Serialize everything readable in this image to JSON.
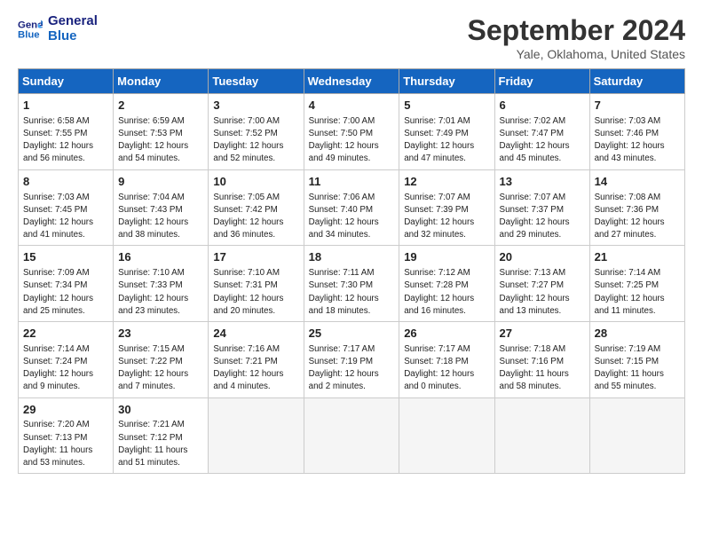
{
  "logo": {
    "line1": "General",
    "line2": "Blue"
  },
  "title": "September 2024",
  "subtitle": "Yale, Oklahoma, United States",
  "weekdays": [
    "Sunday",
    "Monday",
    "Tuesday",
    "Wednesday",
    "Thursday",
    "Friday",
    "Saturday"
  ],
  "weeks": [
    [
      {
        "day": "1",
        "info": "Sunrise: 6:58 AM\nSunset: 7:55 PM\nDaylight: 12 hours\nand 56 minutes."
      },
      {
        "day": "2",
        "info": "Sunrise: 6:59 AM\nSunset: 7:53 PM\nDaylight: 12 hours\nand 54 minutes."
      },
      {
        "day": "3",
        "info": "Sunrise: 7:00 AM\nSunset: 7:52 PM\nDaylight: 12 hours\nand 52 minutes."
      },
      {
        "day": "4",
        "info": "Sunrise: 7:00 AM\nSunset: 7:50 PM\nDaylight: 12 hours\nand 49 minutes."
      },
      {
        "day": "5",
        "info": "Sunrise: 7:01 AM\nSunset: 7:49 PM\nDaylight: 12 hours\nand 47 minutes."
      },
      {
        "day": "6",
        "info": "Sunrise: 7:02 AM\nSunset: 7:47 PM\nDaylight: 12 hours\nand 45 minutes."
      },
      {
        "day": "7",
        "info": "Sunrise: 7:03 AM\nSunset: 7:46 PM\nDaylight: 12 hours\nand 43 minutes."
      }
    ],
    [
      {
        "day": "8",
        "info": "Sunrise: 7:03 AM\nSunset: 7:45 PM\nDaylight: 12 hours\nand 41 minutes."
      },
      {
        "day": "9",
        "info": "Sunrise: 7:04 AM\nSunset: 7:43 PM\nDaylight: 12 hours\nand 38 minutes."
      },
      {
        "day": "10",
        "info": "Sunrise: 7:05 AM\nSunset: 7:42 PM\nDaylight: 12 hours\nand 36 minutes."
      },
      {
        "day": "11",
        "info": "Sunrise: 7:06 AM\nSunset: 7:40 PM\nDaylight: 12 hours\nand 34 minutes."
      },
      {
        "day": "12",
        "info": "Sunrise: 7:07 AM\nSunset: 7:39 PM\nDaylight: 12 hours\nand 32 minutes."
      },
      {
        "day": "13",
        "info": "Sunrise: 7:07 AM\nSunset: 7:37 PM\nDaylight: 12 hours\nand 29 minutes."
      },
      {
        "day": "14",
        "info": "Sunrise: 7:08 AM\nSunset: 7:36 PM\nDaylight: 12 hours\nand 27 minutes."
      }
    ],
    [
      {
        "day": "15",
        "info": "Sunrise: 7:09 AM\nSunset: 7:34 PM\nDaylight: 12 hours\nand 25 minutes."
      },
      {
        "day": "16",
        "info": "Sunrise: 7:10 AM\nSunset: 7:33 PM\nDaylight: 12 hours\nand 23 minutes."
      },
      {
        "day": "17",
        "info": "Sunrise: 7:10 AM\nSunset: 7:31 PM\nDaylight: 12 hours\nand 20 minutes."
      },
      {
        "day": "18",
        "info": "Sunrise: 7:11 AM\nSunset: 7:30 PM\nDaylight: 12 hours\nand 18 minutes."
      },
      {
        "day": "19",
        "info": "Sunrise: 7:12 AM\nSunset: 7:28 PM\nDaylight: 12 hours\nand 16 minutes."
      },
      {
        "day": "20",
        "info": "Sunrise: 7:13 AM\nSunset: 7:27 PM\nDaylight: 12 hours\nand 13 minutes."
      },
      {
        "day": "21",
        "info": "Sunrise: 7:14 AM\nSunset: 7:25 PM\nDaylight: 12 hours\nand 11 minutes."
      }
    ],
    [
      {
        "day": "22",
        "info": "Sunrise: 7:14 AM\nSunset: 7:24 PM\nDaylight: 12 hours\nand 9 minutes."
      },
      {
        "day": "23",
        "info": "Sunrise: 7:15 AM\nSunset: 7:22 PM\nDaylight: 12 hours\nand 7 minutes."
      },
      {
        "day": "24",
        "info": "Sunrise: 7:16 AM\nSunset: 7:21 PM\nDaylight: 12 hours\nand 4 minutes."
      },
      {
        "day": "25",
        "info": "Sunrise: 7:17 AM\nSunset: 7:19 PM\nDaylight: 12 hours\nand 2 minutes."
      },
      {
        "day": "26",
        "info": "Sunrise: 7:17 AM\nSunset: 7:18 PM\nDaylight: 12 hours\nand 0 minutes."
      },
      {
        "day": "27",
        "info": "Sunrise: 7:18 AM\nSunset: 7:16 PM\nDaylight: 11 hours\nand 58 minutes."
      },
      {
        "day": "28",
        "info": "Sunrise: 7:19 AM\nSunset: 7:15 PM\nDaylight: 11 hours\nand 55 minutes."
      }
    ],
    [
      {
        "day": "29",
        "info": "Sunrise: 7:20 AM\nSunset: 7:13 PM\nDaylight: 11 hours\nand 53 minutes."
      },
      {
        "day": "30",
        "info": "Sunrise: 7:21 AM\nSunset: 7:12 PM\nDaylight: 11 hours\nand 51 minutes."
      },
      {
        "day": "",
        "info": ""
      },
      {
        "day": "",
        "info": ""
      },
      {
        "day": "",
        "info": ""
      },
      {
        "day": "",
        "info": ""
      },
      {
        "day": "",
        "info": ""
      }
    ]
  ]
}
